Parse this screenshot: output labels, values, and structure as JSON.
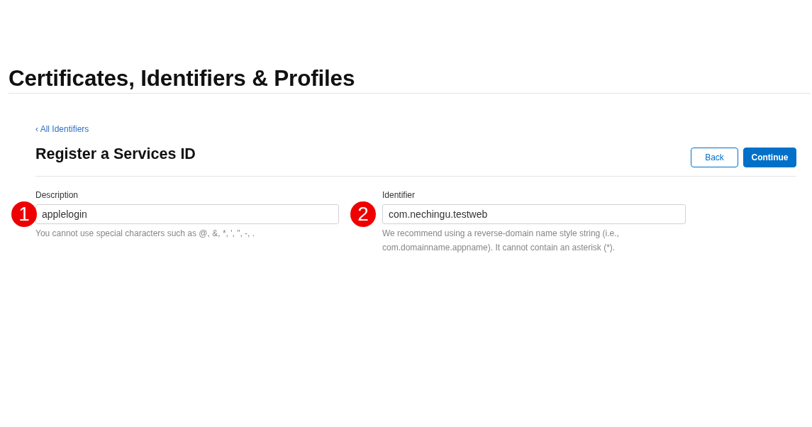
{
  "header": {
    "title": "Certificates, Identifiers & Profiles"
  },
  "back_link": "‹ All Identifiers",
  "page_title": "Register a Services ID",
  "buttons": [
    {
      "label": "Back",
      "kind": "secondary"
    },
    {
      "label": "Continue",
      "kind": "primary"
    }
  ],
  "fields": [
    {
      "marker": "1",
      "label": "Description",
      "value": "applelogin",
      "help": "You cannot use special characters such as @, &, *, ', \", -, ."
    },
    {
      "marker": "2",
      "label": "Identifier",
      "value": "com.nechingu.testweb",
      "help": "We recommend using a reverse-domain name style string (i.e., com.domainname.appname). It cannot contain an asterisk (*)."
    }
  ]
}
